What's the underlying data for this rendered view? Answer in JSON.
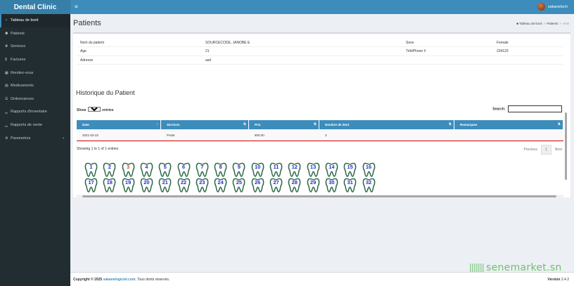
{
  "brand": "Dental Clinic",
  "user": {
    "name": "sakanetech"
  },
  "sidebar": {
    "items": [
      {
        "label": "Tableau de bord",
        "icon": "dashboard-icon"
      },
      {
        "label": "Patients",
        "icon": "users-icon"
      },
      {
        "label": "Services",
        "icon": "services-icon"
      },
      {
        "label": "Factures",
        "icon": "dollar-icon"
      },
      {
        "label": "Rendez-vous",
        "icon": "calendar-icon"
      },
      {
        "label": "Medicaments",
        "icon": "medication-icon"
      },
      {
        "label": "Ordonnances",
        "icon": "list-icon"
      },
      {
        "label": "Rapports d'inventaire",
        "icon": "chart-icon"
      },
      {
        "label": "Rapports de vente",
        "icon": "chart-icon"
      },
      {
        "label": "Parametres",
        "icon": "gear-icon"
      }
    ]
  },
  "page": {
    "title": "Patients"
  },
  "breadcrumb": {
    "home": "Tableau de bord",
    "section": "Patients",
    "current": "view"
  },
  "patient": {
    "name_label": "Nom du patient",
    "name": "SOURCECODE, JANOBE E",
    "sex_label": "Sexe",
    "sex": "Female",
    "age_label": "Age",
    "age": "21",
    "phone_label": "TéléPhone #",
    "phone": "234123",
    "address_label": "Adresse",
    "address": "asd"
  },
  "history": {
    "title": "Historique du Patient"
  },
  "table": {
    "show_label": "Show",
    "entries_label": "entries",
    "page_size": "50",
    "search_label": "Search:",
    "columns": [
      "Date",
      "Services",
      "Prix",
      "Nombre de dent",
      "Remarques"
    ],
    "rows": [
      [
        "2021-02-22",
        "Poste",
        "800.00",
        "3",
        ""
      ]
    ],
    "info": "Showing 1 to 1 of 1 entries",
    "prev": "Previous",
    "page": "1",
    "next": "Next"
  },
  "teeth": {
    "numbers": [
      "1",
      "2",
      "3",
      "4",
      "5",
      "6",
      "7",
      "8",
      "9",
      "10",
      "11",
      "12",
      "13",
      "14",
      "15",
      "16",
      "17",
      "18",
      "19",
      "20",
      "21",
      "22",
      "23",
      "24",
      "25",
      "26",
      "27",
      "28",
      "29",
      "30",
      "31",
      "32"
    ],
    "highlighted": [
      "3"
    ]
  },
  "footer": {
    "copyright": "Copyright © 2025",
    "link": "sakanelogiciel.com",
    "rights": ". Tous droits réservés.",
    "version_label": "Version",
    "version": "2.4.2"
  },
  "watermark": "senemarket.sn",
  "colors": {
    "header": "#3c8dbc",
    "sidebar": "#222d32",
    "tooth_number": "#2a2adb",
    "tooth_highlight": "#d84b3b"
  }
}
